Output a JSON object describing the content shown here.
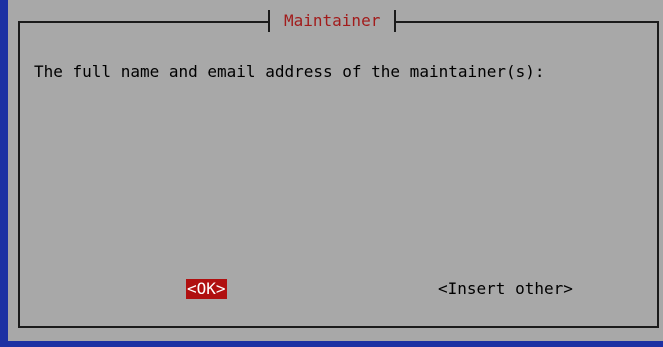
{
  "dialog": {
    "title": "Maintainer",
    "prompt": "The full name and email address of the maintainer(s):"
  },
  "buttons": {
    "ok_label": "<OK>",
    "insert_other_label": "<Insert other>"
  },
  "colors": {
    "background_blue": "#1c31a3",
    "dialog_gray": "#a8a8a8",
    "title_red": "#a21c1c",
    "selected_button_bg": "#b01010"
  }
}
